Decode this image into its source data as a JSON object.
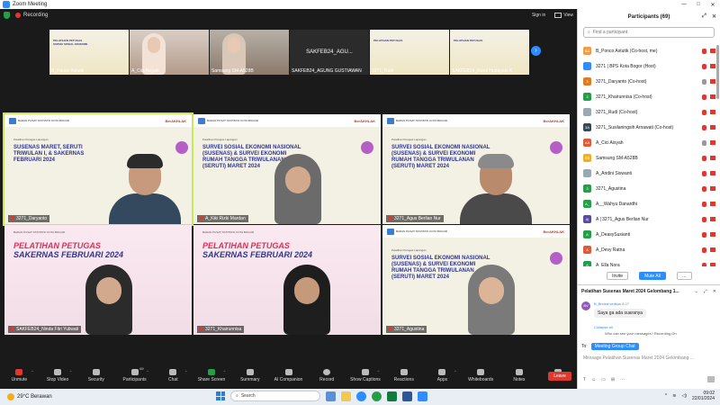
{
  "window": {
    "title": "Zoom Meeting",
    "minimize": "—",
    "maximize": "□",
    "close": "✕"
  },
  "topbar": {
    "recording": "Recording",
    "signin": "Sign in",
    "view": "View"
  },
  "strip": [
    {
      "name": "B_Ponco Astutik",
      "kind": "slide",
      "slide_title": "PELATIHAN PETUGAS SURVEI SOSIAL EKONOMI"
    },
    {
      "name": "A_Cici Aisyah",
      "kind": "person"
    },
    {
      "name": "Samsung SM-A528B",
      "kind": "person"
    },
    {
      "name": "SAKFEB24_AGUNG GUSTIAWAN",
      "kind": "dark",
      "display": "SAKFEB24_AGU..."
    },
    {
      "name": "3271_Rudi",
      "kind": "slide",
      "slide_title": "PELATIHAN PETUGAS"
    },
    {
      "name": "SAKFEB24_Nurul Hudayani K",
      "kind": "slide",
      "slide_title": "PELATIHAN PETUGAS"
    }
  ],
  "tiles": [
    {
      "name": "3271_Daryanto",
      "title": "SUSENAS MARET, SERUTI TRIWULAN I, & SAKERNAS FEBRUARI 2024",
      "sub": "Pelatihan Petugas Lapangan",
      "style": "slide-person",
      "active": true
    },
    {
      "name": "A_Kiki Rizki Mardan",
      "title": "SURVEI SOSIAL EKONOMI NASIONAL (SUSENAS) & SURVEI EKONOMI RUMAH TANGGA TRIWULANAN (SERUTI) MARET 2024",
      "sub": "Pelatihan Petugas Lapangan",
      "style": "slide-hijab"
    },
    {
      "name": "3271_Agus Berlian Nur",
      "title": "SURVEI SOSIAL EKONOMI NASIONAL (SUSENAS) & SURVEI EKONOMI RUMAH TANGGA TRIWULANAN (SERUTI) MARET 2024",
      "sub": "Pelatihan Petugas Lapangan",
      "style": "slide-man"
    },
    {
      "name": "SAKFEB24_Ninda Fitri Yuliwati",
      "title": "PELATIHAN PETUGAS",
      "title2": "SAKERNAS FEBRUARI 2024",
      "sub": "BADAN PUSAT STATISTIK KOTA BOGOR",
      "style": "pink-hijab"
    },
    {
      "name": "3271_Khairunnisa",
      "title": "PELATIHAN PETUGAS",
      "title2": "SAKERNAS FEBRUARI 2024",
      "sub": "BADAN PUSAT STATISTIK KOTA BOGOR",
      "style": "pink-hijab2"
    },
    {
      "name": "3271_Agustina",
      "title": "SURVEI SOSIAL EKONOMI NASIONAL (SUSENAS) & SURVEI EKONOMI RUMAH TANGGA TRIWULANAN (SERUTI) MARET 2024",
      "sub": "Pelatihan Petugas Lapangan",
      "style": "slide-hijab3"
    }
  ],
  "tile_brand": {
    "bps": "BADAN PUSAT STATISTIK KOTA BOGOR",
    "berakhlak": "BerAKHLAK"
  },
  "toolbar": {
    "unmute": "Unmute",
    "stop_video": "Stop Video",
    "security": "Security",
    "participants": "Participants",
    "participants_count": "69",
    "chat": "Chat",
    "share_screen": "Share Screen",
    "summary": "Summary",
    "ai_companion": "AI Companion",
    "record": "Record",
    "show_captions": "Show Captions",
    "reactions": "Reactions",
    "apps": "Apps",
    "whiteboards": "Whiteboards",
    "notes": "Notes",
    "more": "More",
    "leave": "Leave"
  },
  "participants": {
    "title": "Participants (69)",
    "search_placeholder": "Find a participant",
    "list": [
      {
        "initials": "BA",
        "name": "B_Ponco Astutik (Co-host, me)",
        "color": "#f2994a",
        "mic": "red"
      },
      {
        "initials": "",
        "name": "3271 | BPS Kota Bogor (Host)",
        "color": "#2d8cff",
        "mic": "red"
      },
      {
        "initials": "3",
        "name": "3271_Daryanto (Co-host)",
        "color": "#e07b24",
        "mic": "gray"
      },
      {
        "initials": "3",
        "name": "3271_Khairunnisa (Co-host)",
        "color": "#23a047",
        "mic": "red"
      },
      {
        "initials": "",
        "name": "3271_Rudi (Co-host)",
        "color": "#9aa7b5",
        "mic": "red"
      },
      {
        "initials": "3A",
        "name": "3271_Susilaningsih Arnawati (Co-host)",
        "color": "#34495e",
        "mic": "red"
      },
      {
        "initials": "AA",
        "name": "A_Cici Aisyah",
        "color": "#e05a3a",
        "mic": "gray"
      },
      {
        "initials": "SS",
        "name": "Samsung SM-A528B",
        "color": "#f2b01e",
        "mic": "red"
      },
      {
        "initials": "",
        "name": "A_Andini Siswanti",
        "color": "#9aa7b5",
        "mic": "red"
      },
      {
        "initials": "3",
        "name": "3271_Agustina",
        "color": "#23a047",
        "mic": "red"
      },
      {
        "initials": "A_",
        "name": "A__Wahyu Danardhi",
        "color": "#23a047",
        "mic": "red"
      },
      {
        "initials": "A|",
        "name": "A | 3271_Agus Berlian Nur",
        "color": "#5b4aa0",
        "mic": "red"
      },
      {
        "initials": "A",
        "name": "A_DeasySusianti",
        "color": "#23a047",
        "mic": "red"
      },
      {
        "initials": "A",
        "name": "A_Devy Ratna",
        "color": "#e05a3a",
        "mic": "red"
      },
      {
        "initials": "A",
        "name": "A_Ella Nora",
        "color": "#23a047",
        "mic": "red"
      }
    ],
    "invite": "Invite",
    "mute_all": "Mute All",
    "more": "…"
  },
  "chat": {
    "title": "Pelatihan Susenas Maret 2024 Gelombang 1...",
    "avatar": "BV",
    "sender": "B_Brvina vedsus",
    "time": "8:27",
    "message": "Saya ga ada suaranya",
    "collapse": "Collapse all",
    "who_can_see": "Who can see your messages? Recording On",
    "to_label": "To:",
    "to_value": "Meeting Group Chat",
    "input_placeholder": "Message Pelatihan Susenas Maret 2024 Gelombang ..."
  },
  "taskbar": {
    "temp": "29°C",
    "weather": "Berawan",
    "search": "Search",
    "time": "09:02",
    "date": "22/01/2024"
  }
}
